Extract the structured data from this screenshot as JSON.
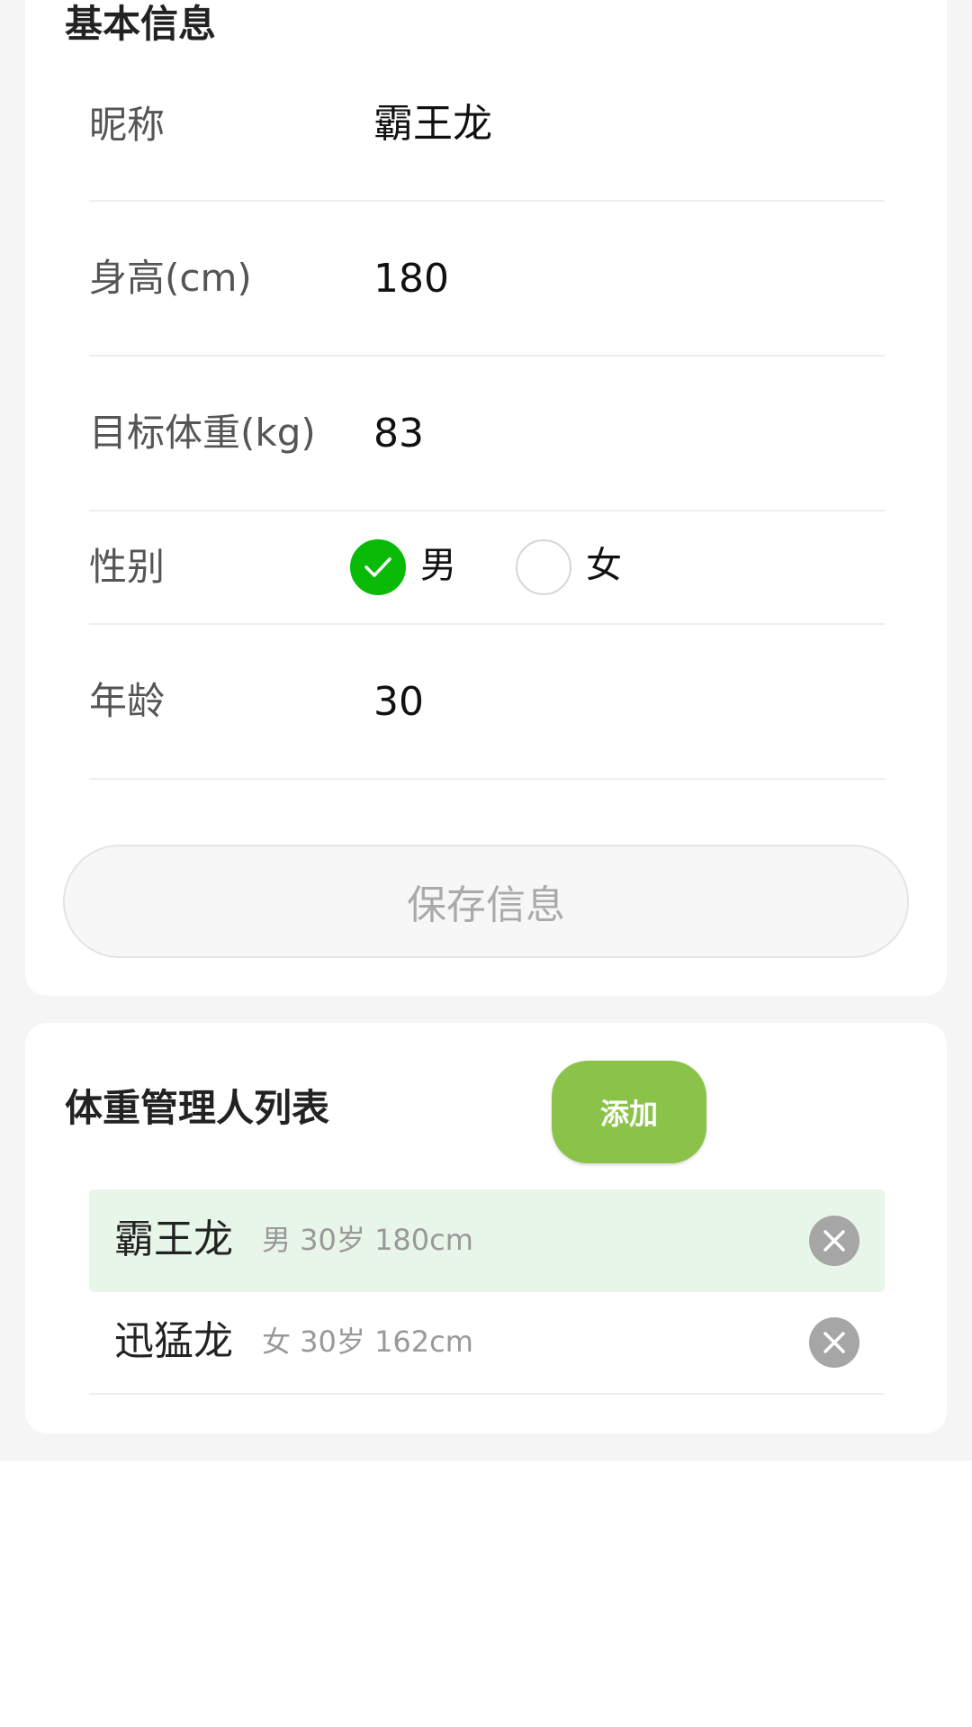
{
  "basic_info": {
    "title": "基本信息",
    "nickname": {
      "label": "昵称",
      "value": "霸王龙"
    },
    "height": {
      "label": "身高(cm)",
      "value": "180"
    },
    "target_weight": {
      "label": "目标体重(kg)",
      "value": "83"
    },
    "gender": {
      "label": "性别",
      "options": [
        {
          "label": "男",
          "checked": true
        },
        {
          "label": "女",
          "checked": false
        }
      ]
    },
    "age": {
      "label": "年龄",
      "value": "30"
    },
    "save_label": "保存信息"
  },
  "manager_list": {
    "title": "体重管理人列表",
    "add_label": "添加",
    "people": [
      {
        "name": "霸王龙",
        "info": "男 30岁 180cm",
        "active": true
      },
      {
        "name": "迅猛龙",
        "info": "女 30岁 162cm",
        "active": false
      }
    ]
  },
  "colors": {
    "accent_green": "#09bb07",
    "add_button": "#8bc34a",
    "active_row": "#e8f5e9"
  },
  "icons": {
    "check": "check-icon",
    "close": "close-icon"
  }
}
